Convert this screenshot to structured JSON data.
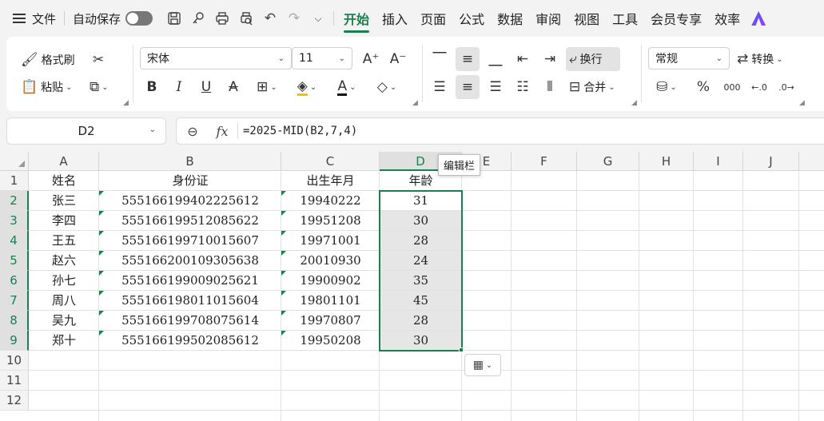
{
  "menubar": {
    "file_label": "文件",
    "autosave_label": "自动保存",
    "tabs": [
      "开始",
      "插入",
      "页面",
      "公式",
      "数据",
      "审阅",
      "视图",
      "工具",
      "会员专享",
      "效率"
    ],
    "active_tab": "开始"
  },
  "ribbon": {
    "format_painter": "格式刷",
    "paste": "粘贴",
    "font_name": "宋体",
    "font_size": "11",
    "wrap_text": "换行",
    "merge": "合并",
    "number_format": "常规",
    "convert": "转换"
  },
  "formula_bar": {
    "name_box": "D2",
    "formula": "=2025-MID(B2,7,4)",
    "tooltip": "编辑栏"
  },
  "sheet": {
    "columns": [
      "A",
      "B",
      "C",
      "D",
      "E",
      "F",
      "G",
      "H",
      "I",
      "J"
    ],
    "rows": [
      "1",
      "2",
      "3",
      "4",
      "5",
      "6",
      "7",
      "8",
      "9",
      "10",
      "11",
      "12"
    ],
    "header": [
      "姓名",
      "身份证",
      "出生年月",
      "年龄"
    ],
    "data": [
      [
        "张三",
        "555166199402225612",
        "19940222",
        "31"
      ],
      [
        "李四",
        "555166199512085622",
        "19951208",
        "30"
      ],
      [
        "王五",
        "555166199710015607",
        "19971001",
        "28"
      ],
      [
        "赵六",
        "555166200109305638",
        "20010930",
        "24"
      ],
      [
        "孙七",
        "555166199009025621",
        "19900902",
        "35"
      ],
      [
        "周八",
        "555166198011015604",
        "19801101",
        "45"
      ],
      [
        "吴九",
        "555166199708075614",
        "19970807",
        "28"
      ],
      [
        "郑十",
        "555166199502085612",
        "19950208",
        "30"
      ]
    ],
    "active_cell": "D2",
    "selection": "D2:D9"
  },
  "colors": {
    "accent": "#1b7f4f",
    "selection_fill": "#e6e6e6"
  }
}
